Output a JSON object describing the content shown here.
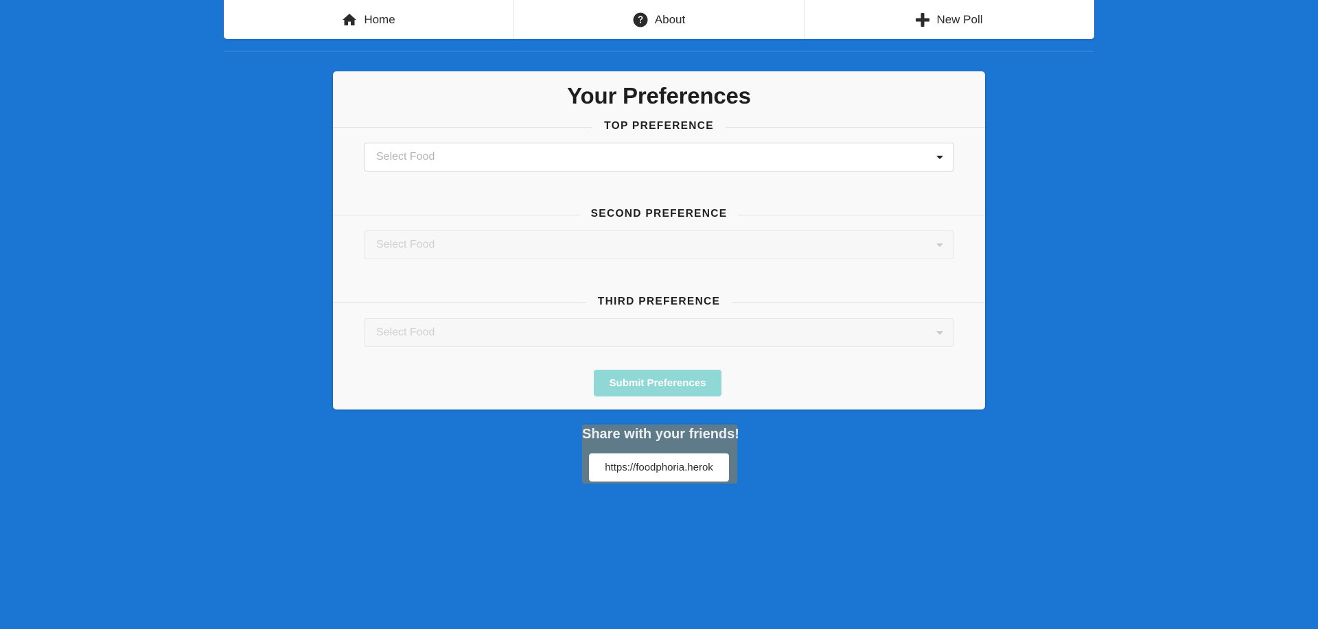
{
  "nav": {
    "items": [
      {
        "label": "Home",
        "icon": "home-icon"
      },
      {
        "label": "About",
        "icon": "question-circle-icon"
      },
      {
        "label": "New Poll",
        "icon": "plus-icon"
      }
    ]
  },
  "card": {
    "title": "Your Preferences",
    "sections": [
      {
        "label": "TOP PREFERENCE",
        "placeholder": "Select Food",
        "enabled": true
      },
      {
        "label": "SECOND PREFERENCE",
        "placeholder": "Select Food",
        "enabled": false
      },
      {
        "label": "THIRD PREFERENCE",
        "placeholder": "Select Food",
        "enabled": false
      }
    ],
    "submit_label": "Submit Preferences"
  },
  "share": {
    "title": "Share with your friends!",
    "url": "https://foodphoria.herok"
  },
  "colors": {
    "background": "#1b76d3",
    "card": "#f9f9f9",
    "submit": "#8fd8d5",
    "share_box": "#5f7b8a"
  }
}
